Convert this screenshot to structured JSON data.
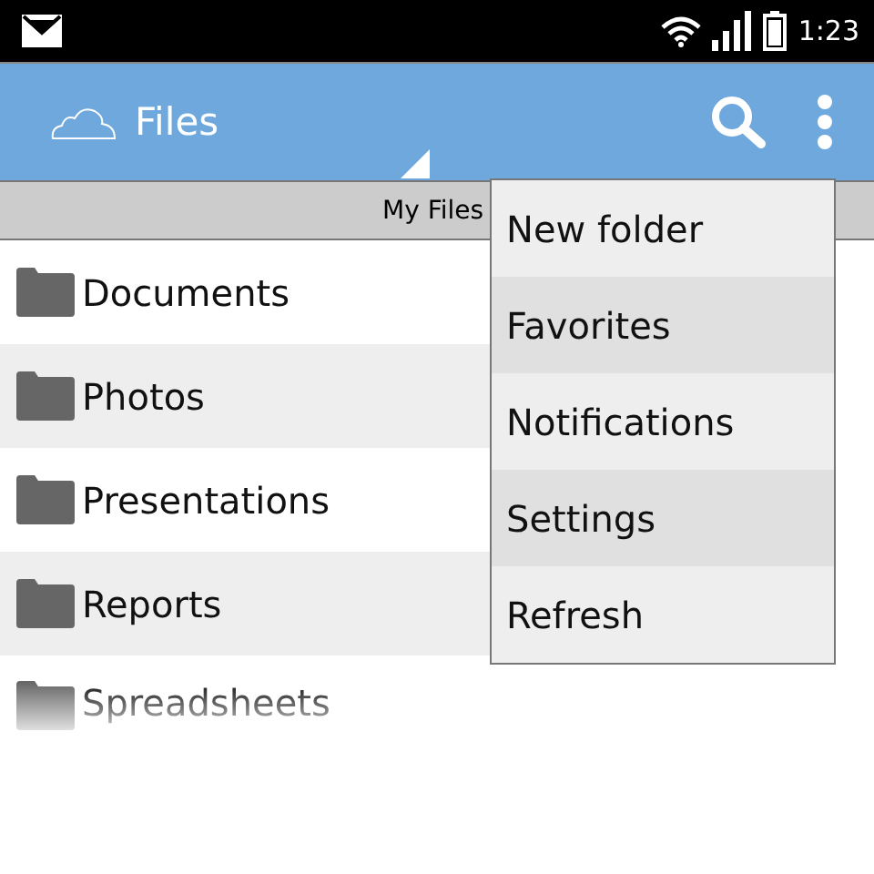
{
  "status_bar": {
    "time": "1:23"
  },
  "app_bar": {
    "title": "Files"
  },
  "breadcrumb": "My Files",
  "folders": [
    {
      "name": "Documents"
    },
    {
      "name": "Photos"
    },
    {
      "name": "Presentations"
    },
    {
      "name": "Reports"
    },
    {
      "name": "Spreadsheets"
    }
  ],
  "menu": {
    "items": [
      "New folder",
      "Favorites",
      "Notifications",
      "Settings",
      "Refresh"
    ]
  }
}
